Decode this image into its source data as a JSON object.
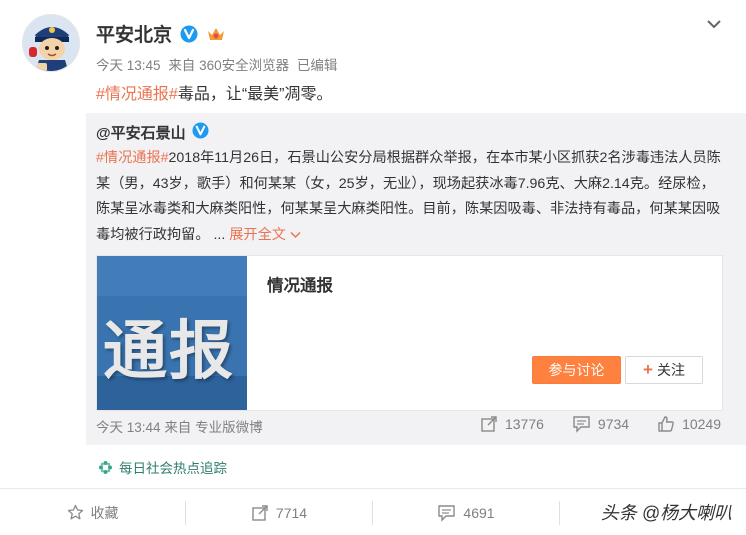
{
  "post": {
    "author": "平安北京",
    "meta": {
      "time": "今天 13:45",
      "source": "来自 360安全浏览器",
      "edited": "已编辑"
    },
    "text": {
      "topic": "#情况通报#",
      "rest": "毒品，让“最美”凋零。"
    }
  },
  "repost": {
    "author": "@平安石景山",
    "topic": "#情况通报#",
    "body": "2018年11月26日，石景山公安分局根据群众举报，在本市某小区抓获2名涉毒违法人员陈某（男，43岁，歌手）和何某某（女，25岁，无业），现场起获冰毒7.96克、大麻2.14克。经尿检，陈某呈冰毒类和大麻类阳性，何某某呈大麻类阳性。目前，陈某因吸毒、非法持有毒品，何某某因吸毒均被行政拘留。 ...",
    "expand": "展开全文",
    "card": {
      "image_text": "通报",
      "title": "情况通报",
      "discuss": "参与讨论",
      "follow": "关注"
    },
    "meta": {
      "time": "今天 13:44",
      "source": "来自 专业版微博"
    },
    "stats": {
      "reposts": "13776",
      "comments": "9734",
      "likes": "10249"
    }
  },
  "tag_line": "每日社会热点追踪",
  "toolbar": {
    "favorite": "收藏",
    "repost": "7714",
    "comment": "4691"
  },
  "watermark": "头条 @杨大喇叭",
  "colors": {
    "link": "#eb7350",
    "button": "#ff8140",
    "verified": "#1e9bf0"
  }
}
